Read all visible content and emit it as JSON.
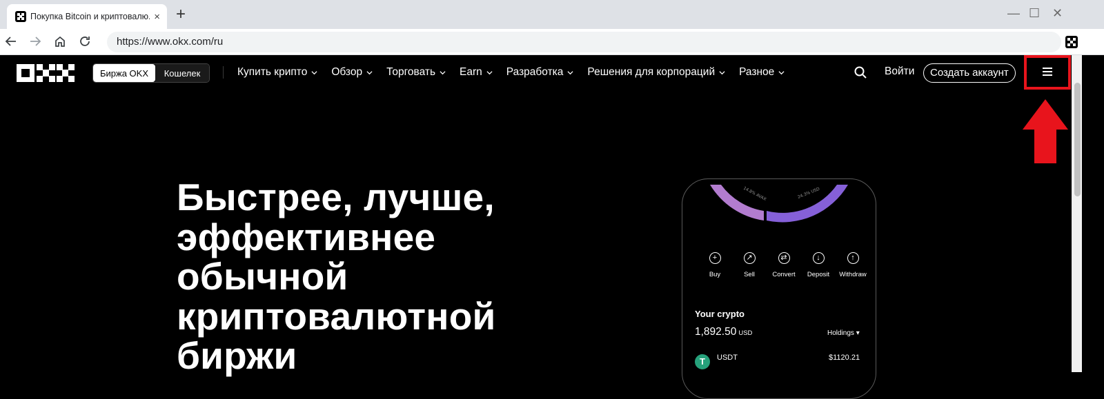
{
  "browser": {
    "tab_title": "Покупка Bitcoin и криптовалю...",
    "tab_close": "×",
    "new_tab": "+",
    "url": "https://www.okx.com/ru",
    "window_controls": {
      "minimize": "—",
      "maximize": "☐",
      "close": "✕"
    },
    "icons": [
      "back-icon",
      "forward-icon",
      "home-icon",
      "reload-icon",
      "extension-icon"
    ]
  },
  "header": {
    "logo": "OKX",
    "switcher": {
      "exchange": "Биржа OKX",
      "wallet": "Кошелек"
    },
    "nav": [
      {
        "label": "Купить крипто"
      },
      {
        "label": "Обзор"
      },
      {
        "label": "Торговать"
      },
      {
        "label": "Earn"
      },
      {
        "label": "Разработка"
      },
      {
        "label": "Решения для корпораций"
      },
      {
        "label": "Разное"
      }
    ],
    "login": "Войти",
    "signup": "Создать аккаунт"
  },
  "annotation": {
    "highlight_color": "#e8141c"
  },
  "hero": {
    "title_lines": [
      "Быстрее, лучше,",
      "эффективнее",
      "обычной",
      "криптовалютной",
      "биржи"
    ]
  },
  "phone": {
    "donut_labels": {
      "left": "14.8% AVAX",
      "right": "24.3% USD"
    },
    "actions": [
      {
        "label": "Buy",
        "glyph": "+"
      },
      {
        "label": "Sell",
        "glyph": "↗"
      },
      {
        "label": "Convert",
        "glyph": "⇄"
      },
      {
        "label": "Deposit",
        "glyph": "↓"
      },
      {
        "label": "Withdraw",
        "glyph": "↑"
      }
    ],
    "your_crypto": "Your crypto",
    "amount": "1,892.50",
    "currency": "USD",
    "holdings": "Holdings ▾",
    "asset": {
      "symbol": "T",
      "name": "USDT",
      "value": "$1120.21"
    }
  },
  "colors": {
    "brand_bg": "#000000",
    "donut_pink": "#b27ccf",
    "donut_purple": "#8560d8",
    "usdt": "#26a17b"
  }
}
